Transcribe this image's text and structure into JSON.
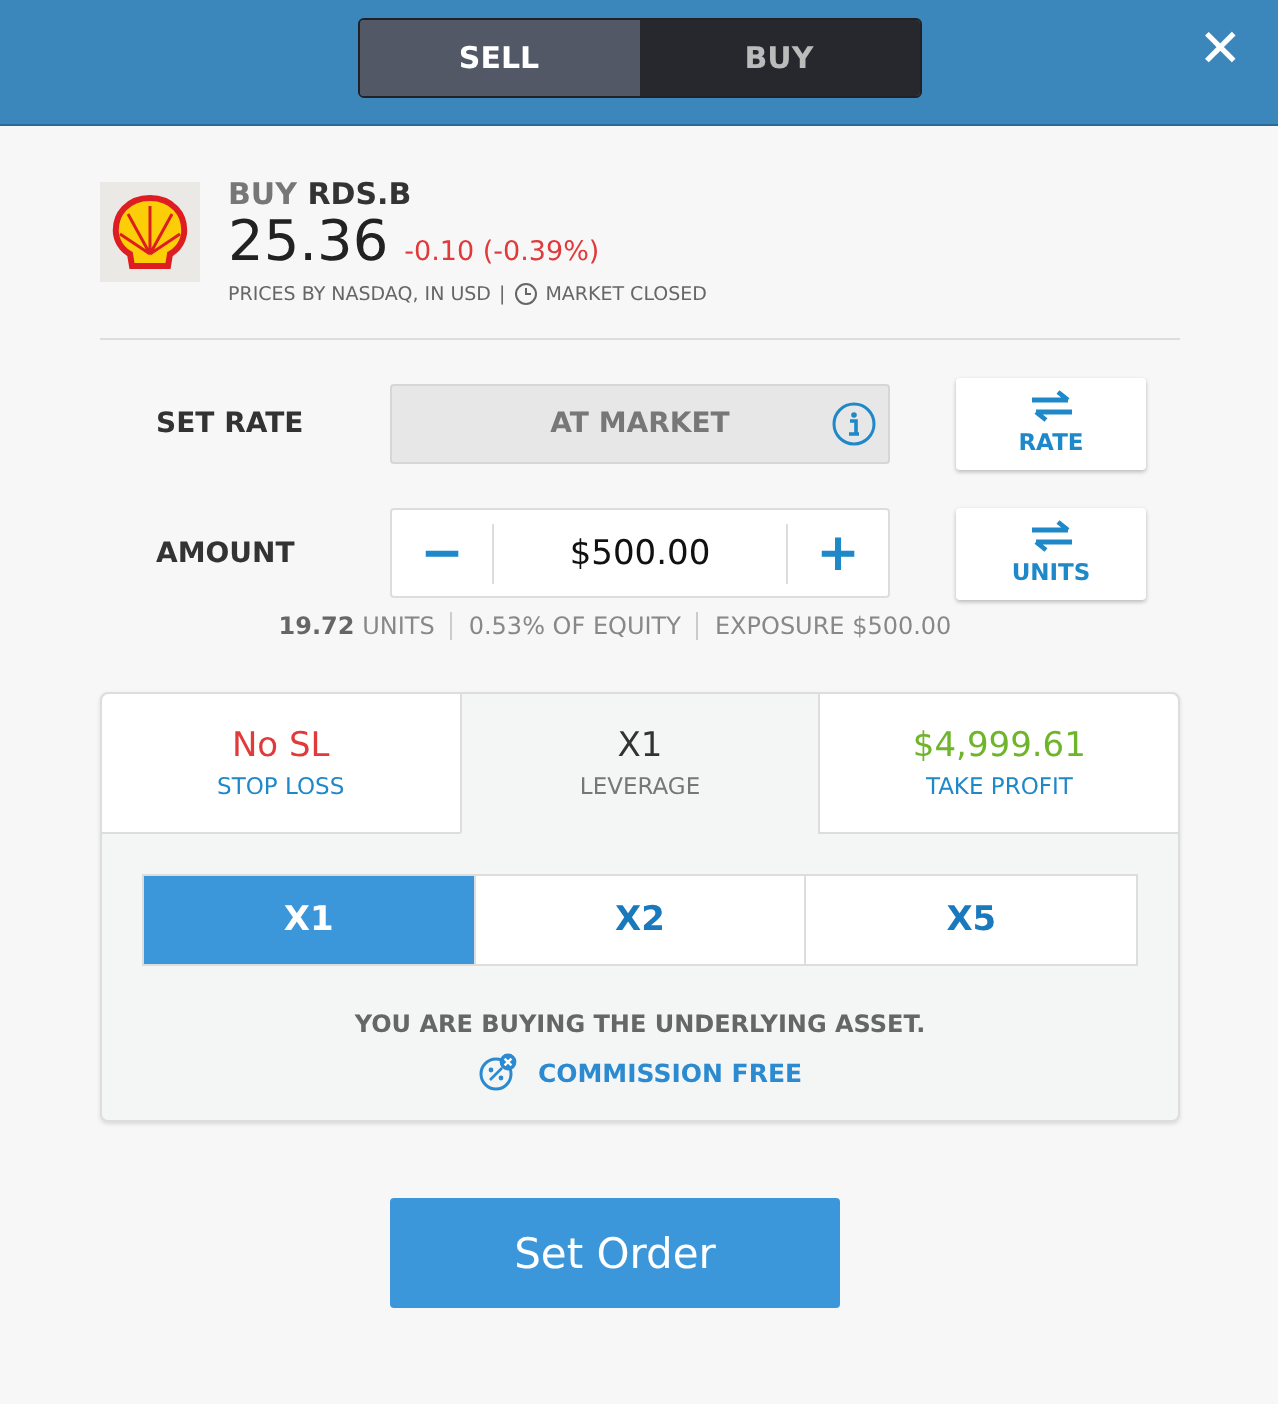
{
  "mode_toggle": [
    {
      "label": "SELL",
      "selected": false
    },
    {
      "label": "BUY",
      "selected": true
    }
  ],
  "close": "✕",
  "instrument": {
    "action": "BUY",
    "symbol": "RDS.B",
    "price": "25.36",
    "change": "-0.10 (-0.39%)",
    "source": "PRICES BY NASDAQ, IN USD",
    "separator": "|",
    "market_status": "MARKET CLOSED"
  },
  "set_rate": {
    "label": "SET RATE",
    "value": "AT MARKET",
    "toggle": "RATE"
  },
  "amount": {
    "label": "AMOUNT",
    "minus": "−",
    "value": "$500.00",
    "plus": "+",
    "toggle": "UNITS"
  },
  "amount_info": {
    "units_value": "19.72",
    "units_label": "UNITS",
    "equity": "0.53% OF EQUITY",
    "exposure": "EXPOSURE $500.00"
  },
  "tabs": [
    {
      "value": "No SL",
      "label": "STOP LOSS",
      "selected": false,
      "color": "#e03a3a"
    },
    {
      "value": "X1",
      "label": "LEVERAGE",
      "selected": true,
      "color": "#333333"
    },
    {
      "value": "$4,999.61",
      "label": "TAKE PROFIT",
      "selected": false,
      "color": "#6fb52c"
    }
  ],
  "leverage_options": [
    {
      "label": "X1",
      "selected": true
    },
    {
      "label": "X2",
      "selected": false
    },
    {
      "label": "X5",
      "selected": false
    }
  ],
  "note": "YOU ARE BUYING THE UNDERLYING ASSET.",
  "commission": "COMMISSION FREE",
  "submit": "Set Order"
}
